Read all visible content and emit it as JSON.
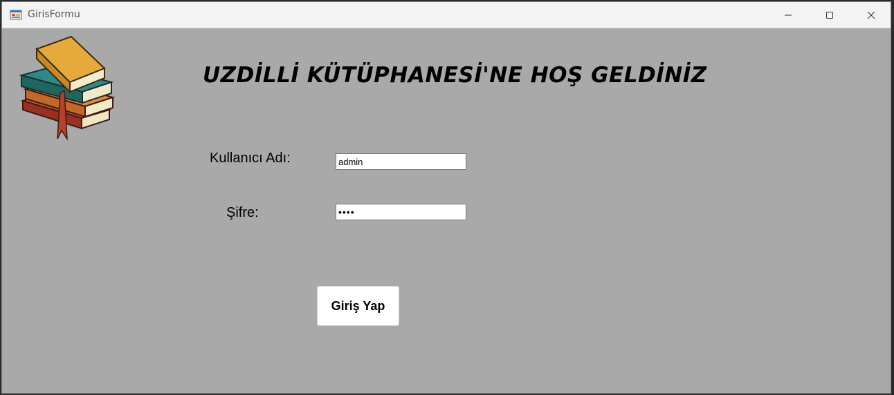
{
  "window": {
    "title": "GirisFormu"
  },
  "heading": "UZDİLLİ KÜTÜPHANESİ'NE HOŞ GELDİNİZ",
  "form": {
    "username_label": "Kullanıcı Adı:",
    "username_value": "admin",
    "password_label": "Şifre:",
    "password_value": "••••",
    "login_button": "Giriş Yap"
  },
  "icons": {
    "app": "form-app-icon",
    "minimize": "minimize-icon",
    "maximize": "maximize-icon",
    "close": "close-icon",
    "books": "books-stack-image"
  },
  "colors": {
    "form_background": "#a9a9a9",
    "titlebar": "#f3f3f3"
  }
}
